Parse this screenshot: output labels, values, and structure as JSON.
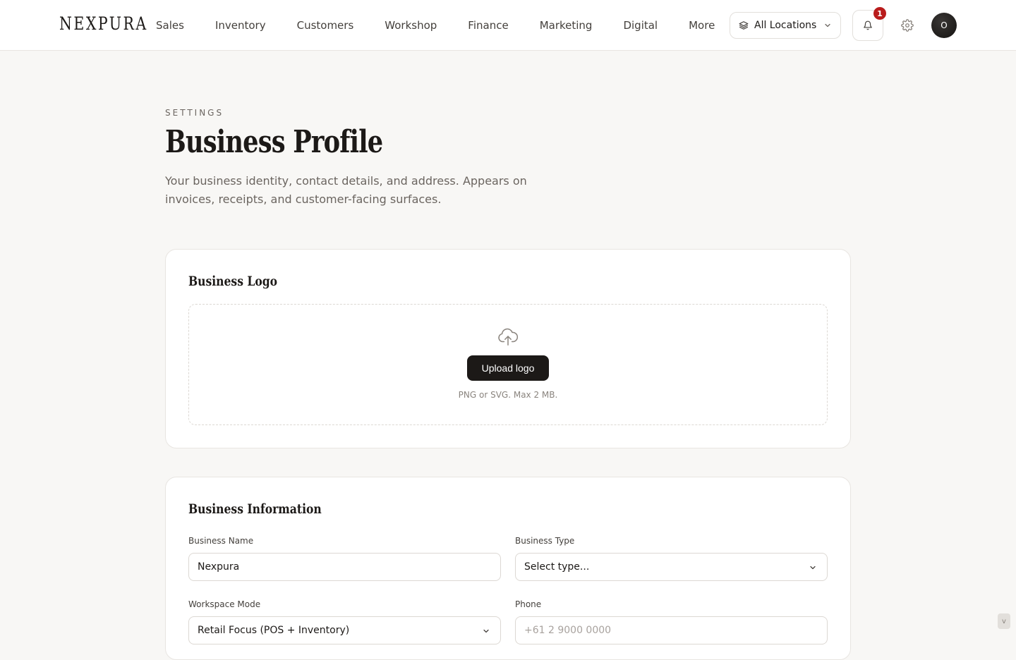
{
  "header": {
    "brand": "NEXPURA",
    "nav": [
      "Sales",
      "Inventory",
      "Customers",
      "Workshop",
      "Finance",
      "Marketing",
      "Digital",
      "More"
    ],
    "location": {
      "label": "All Locations",
      "icon": "layers-icon"
    },
    "notifications": {
      "count": "1",
      "icon": "bell-icon"
    },
    "settings_icon": "gear-icon",
    "avatar_initial": "O"
  },
  "page": {
    "eyebrow": "SETTINGS",
    "title": "Business Profile",
    "description": "Your business identity, contact details, and address. Appears on invoices, receipts, and customer-facing surfaces."
  },
  "logo_card": {
    "title": "Business Logo",
    "upload_icon": "cloud-upload-icon",
    "button": "Upload logo",
    "hint": "PNG or SVG. Max 2 MB."
  },
  "info_card": {
    "title": "Business Information",
    "business_name": {
      "label": "Business Name",
      "value": "Nexpura"
    },
    "business_type": {
      "label": "Business Type",
      "value": "Select type..."
    },
    "workspace_mode": {
      "label": "Workspace Mode",
      "value": "Retail Focus (POS + Inventory)"
    },
    "phone": {
      "label": "Phone",
      "placeholder": "+61 2 9000 0000"
    }
  },
  "scroll_indicator": "v",
  "colors": {
    "background": "#f8f7f5",
    "primary": "#1c1917",
    "badge": "#b91c1c",
    "muted_text": "#6b6560",
    "border": "#e8e5e1"
  }
}
